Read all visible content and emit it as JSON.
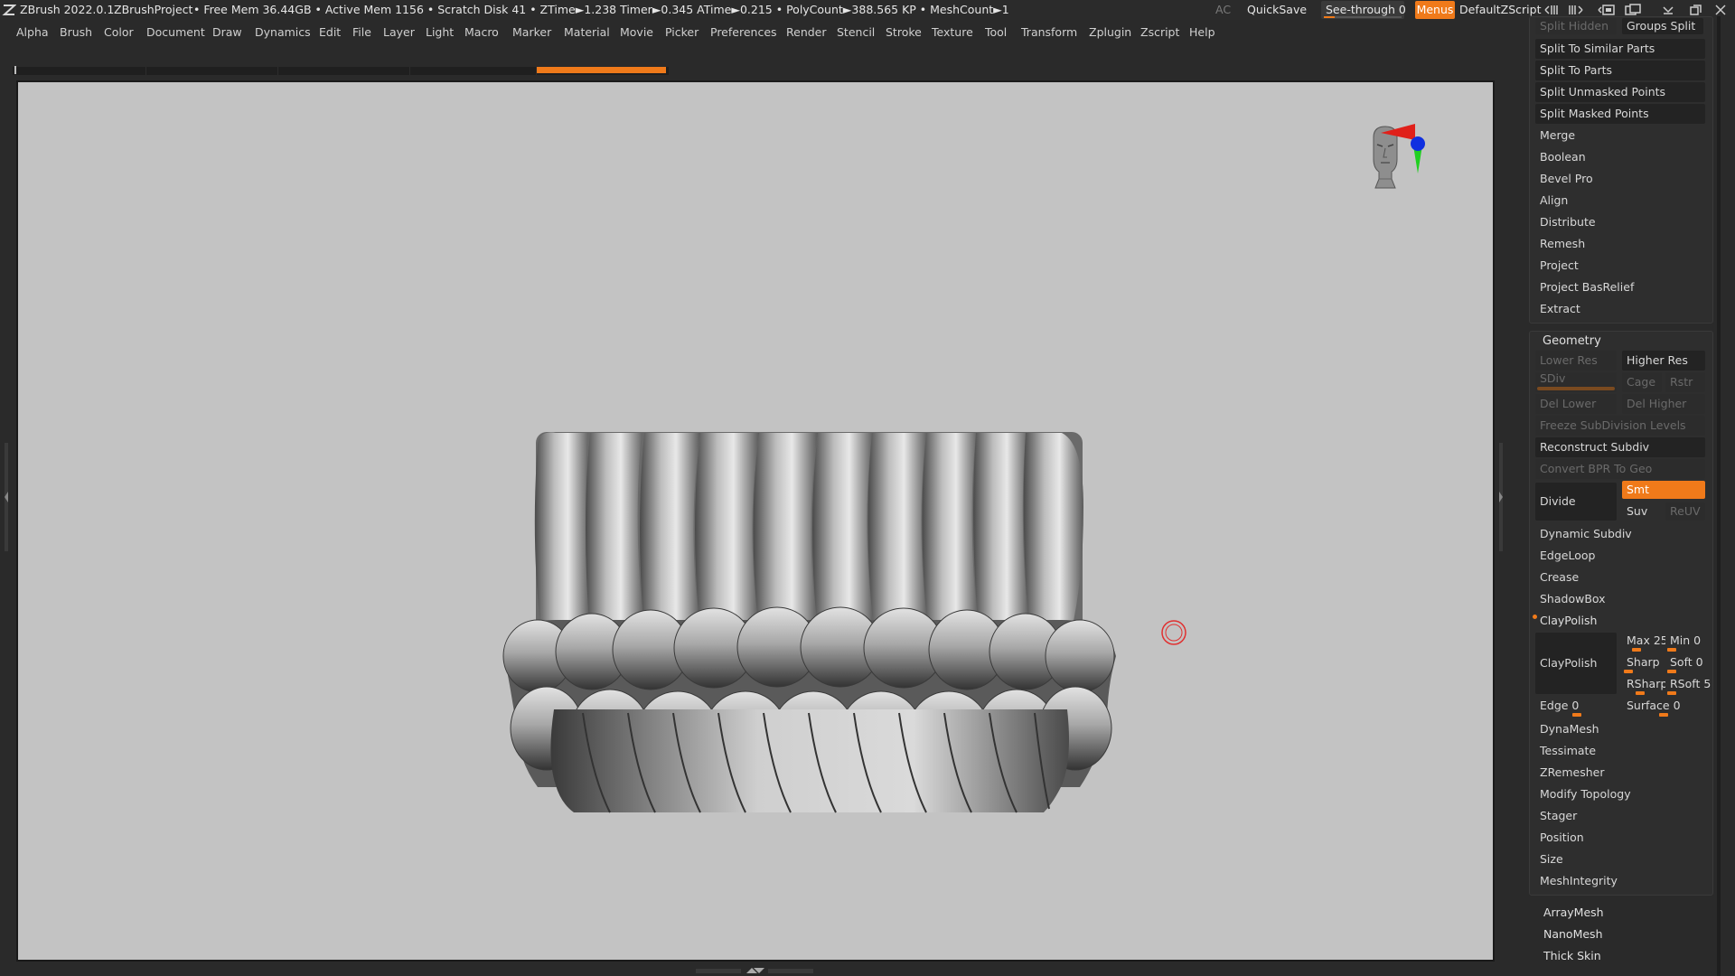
{
  "titlebar": {
    "app": "ZBrush 2022.0.1",
    "project": "ZBrushProject",
    "stats": "• Free Mem 36.44GB • Active Mem 1156 • Scratch Disk 41 •  ZTime►1.238 Timer►0.345 ATime►0.215 • PolyCount►388.565 KP  • MeshCount►1",
    "ac": "AC",
    "quicksave": "QuickSave",
    "seethrough": "See-through  0",
    "seethrough_value": 0,
    "menus": "Menus",
    "script": "DefaultZScript",
    "accent_color": "#f07a1a"
  },
  "menubar": {
    "items": [
      "Alpha",
      "Brush",
      "Color",
      "Document",
      "Draw",
      "Dynamics",
      "Edit",
      "File",
      "Layer",
      "Light",
      "Macro",
      "Marker",
      "Material",
      "Movie",
      "Picker",
      "Preferences",
      "Render",
      "Stencil",
      "Stroke",
      "Texture",
      "Tool",
      "Transform",
      "Zplugin",
      "Zscript",
      "Help"
    ]
  },
  "viewport": {
    "background": "#c3c3c3",
    "navigator_icon": "head-gizmo-icon",
    "axis_colors": {
      "x": "#e0201a",
      "y": "#20d020",
      "z": "#1030e0"
    }
  },
  "subtool_panel": {
    "split_hidden": "Split Hidden",
    "groups_split": "Groups Split",
    "split_similar": "Split To Similar Parts",
    "split_parts": "Split To Parts",
    "split_unmasked": "Split Unmasked Points",
    "split_masked": "Split Masked Points",
    "merge": "Merge",
    "boolean": "Boolean",
    "bevel_pro": "Bevel Pro",
    "align": "Align",
    "distribute": "Distribute",
    "remesh": "Remesh",
    "project": "Project",
    "project_basrelief": "Project BasRelief",
    "extract": "Extract"
  },
  "geometry": {
    "title": "Geometry",
    "lower_res": "Lower Res",
    "higher_res": "Higher Res",
    "sdiv": "SDiv",
    "cage": "Cage",
    "rstr": "Rstr",
    "del_lower": "Del Lower",
    "del_higher": "Del Higher",
    "freeze": "Freeze SubDivision Levels",
    "reconstruct": "Reconstruct Subdiv",
    "convert_bpr": "Convert BPR To Geo",
    "divide": "Divide",
    "smt": "Smt",
    "suv": "Suv",
    "reuv": "ReUV",
    "dynamic_subdiv": "Dynamic Subdiv",
    "edgeloop": "EdgeLoop",
    "crease": "Crease",
    "shadowbox": "ShadowBox",
    "claypolish_header": "ClayPolish",
    "claypolish_btn": "ClayPolish",
    "max": "Max 25",
    "min": "Min 0",
    "sharp": "Sharp",
    "soft": "Soft 0",
    "rsharp": "RSharp",
    "rsoft": "RSoft 5",
    "edge": "Edge 0",
    "surface": "Surface 0",
    "dynamesh": "DynaMesh",
    "tessimate": "Tessimate",
    "zremesher": "ZRemesher",
    "modify_topology": "Modify Topology",
    "stager": "Stager",
    "position": "Position",
    "size": "Size",
    "meshintegrity": "MeshIntegrity"
  },
  "extra_menu": {
    "arraymesh": "ArrayMesh",
    "nanomesh": "NanoMesh",
    "thickskin": "Thick Skin"
  }
}
